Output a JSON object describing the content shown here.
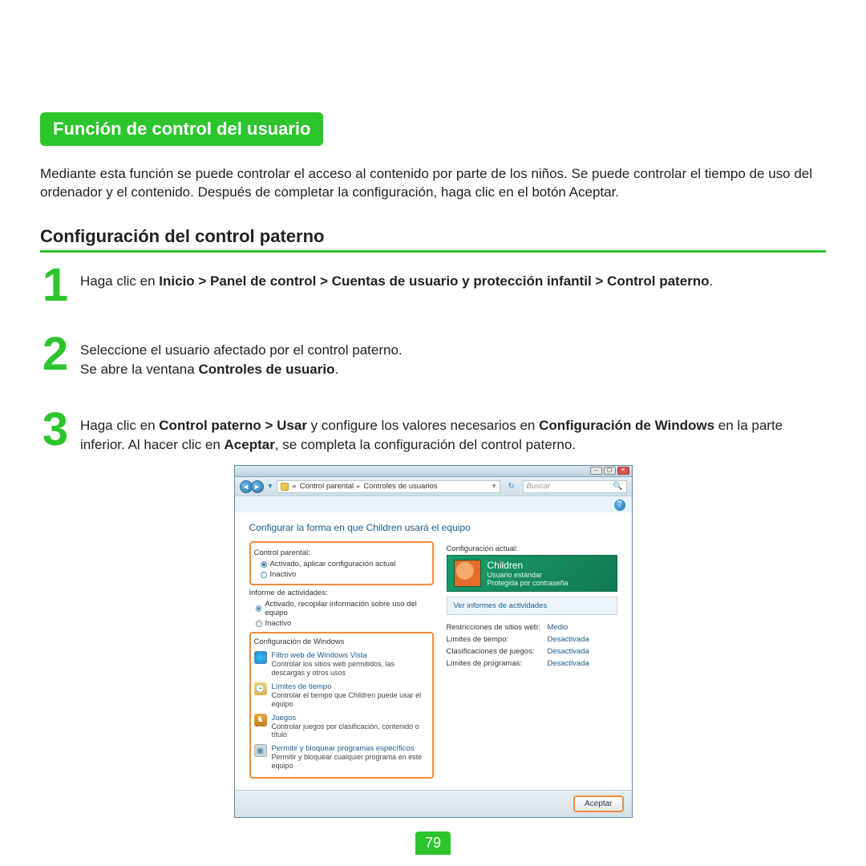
{
  "title_badge": "Función de control del usuario",
  "intro": "Mediante esta función se puede controlar el acceso al contenido por parte de los niños. Se puede controlar el tiempo de uso del ordenador y el contenido. Después de completar la configuración, haga clic en el botón Aceptar.",
  "section_heading": "Configuración del control paterno",
  "steps": {
    "s1": {
      "num": "1",
      "pre": "Haga clic en ",
      "bold": "Inicio > Panel de control > Cuentas de usuario y protección infantil > Control paterno",
      "post": "."
    },
    "s2": {
      "num": "2",
      "line1": "Seleccione el usuario afectado por el control paterno.",
      "line2_pre": "Se abre la ventana ",
      "line2_bold": "Controles de usuario",
      "line2_post": "."
    },
    "s3": {
      "num": "3",
      "pre": "Haga clic en ",
      "bold1": "Control paterno > Usar",
      "mid": " y configure los valores necesarios en ",
      "bold2": "Configuración de Windows",
      "post": " en la parte inferior. Al hacer clic en ",
      "bold3": "Aceptar",
      "post2": ", se completa la configuración del control paterno."
    }
  },
  "vista": {
    "breadcrumb": {
      "a": "Control parental",
      "b": "Controles de usuarios"
    },
    "search_placeholder": "Buscar",
    "body_title": "Configurar la forma en que Children usará el equipo",
    "left": {
      "cp_label": "Control parental:",
      "cp_on": "Activado, aplicar configuración actual",
      "cp_off": "Inactivo",
      "act_label": "Informe de actividades:",
      "act_on": "Activado, recopilar información sobre uso del equipo",
      "act_off": "Inactivo",
      "win_label": "Configuración de Windows",
      "items": [
        {
          "title": "Filtro web de Windows Vista",
          "sub": "Controlar los sitios web permitidos, las descargas y otros usos"
        },
        {
          "title": "Límites de tiempo",
          "sub": "Controlar el tiempo que Children puede usar el equipo"
        },
        {
          "title": "Juegos",
          "sub": "Controlar juegos por clasificación, contenido o título"
        },
        {
          "title": "Permitir y bloquear programas específicos",
          "sub": "Permitir y bloquear cualquier programa en este equipo"
        }
      ]
    },
    "right": {
      "cfg_label": "Configuración actual:",
      "user_name": "Children",
      "user_type": "Usuario estándar",
      "user_pw": "Protegida por contraseña",
      "view_reports": "Ver informes de actividades",
      "rows": [
        {
          "k": "Restricciones de sitios web:",
          "v": "Medio"
        },
        {
          "k": "Límites de tiempo:",
          "v": "Desactivada"
        },
        {
          "k": "Clasificaciones de juegos:",
          "v": "Desactivada"
        },
        {
          "k": "Límites de programas:",
          "v": "Desactivada"
        }
      ]
    },
    "accept": "Aceptar"
  },
  "page_number": "79"
}
